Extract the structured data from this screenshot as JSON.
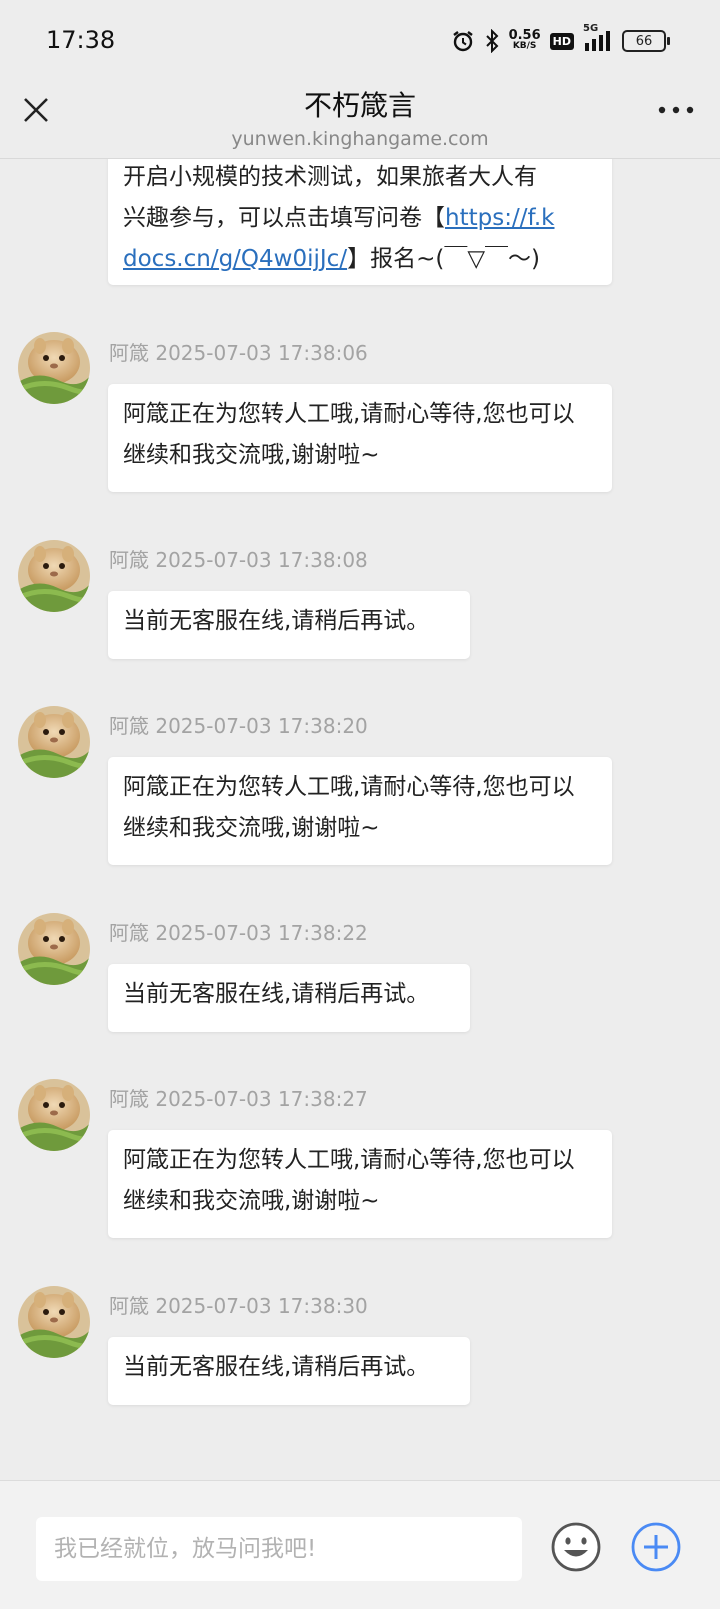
{
  "status_bar": {
    "time": "17:38",
    "net_speed_value": "0.56",
    "net_speed_unit": "KB/S",
    "hd_label": "HD",
    "network_label": "5G",
    "battery": "66"
  },
  "header": {
    "title": "不朽箴言",
    "subtitle": "yunwen.kinghangame.com"
  },
  "first_message": {
    "line1": "开启小规模的技术测试，如果旅者大人有",
    "line2_prefix": "兴趣参与，可以点击填写问卷【",
    "link_part1": "https://f.k",
    "link_part2": "docs.cn/g/Q4w0ijJc/",
    "line3_suffix": "】报名~(￣▽￣～)"
  },
  "messages": [
    {
      "sender": "阿箴",
      "timestamp": "2025-07-03 17:38:06",
      "text": "阿箴正在为您转人工哦,请耐心等待,您也可以继续和我交流哦,谢谢啦~"
    },
    {
      "sender": "阿箴",
      "timestamp": "2025-07-03 17:38:08",
      "text": "当前无客服在线,请稍后再试。"
    },
    {
      "sender": "阿箴",
      "timestamp": "2025-07-03 17:38:20",
      "text": "阿箴正在为您转人工哦,请耐心等待,您也可以继续和我交流哦,谢谢啦~"
    },
    {
      "sender": "阿箴",
      "timestamp": "2025-07-03 17:38:22",
      "text": "当前无客服在线,请稍后再试。"
    },
    {
      "sender": "阿箴",
      "timestamp": "2025-07-03 17:38:27",
      "text": "阿箴正在为您转人工哦,请耐心等待,您也可以继续和我交流哦,谢谢啦~"
    },
    {
      "sender": "阿箴",
      "timestamp": "2025-07-03 17:38:30",
      "text": "当前无客服在线,请稍后再试。"
    }
  ],
  "input": {
    "placeholder": "我已经就位，放马问我吧!"
  },
  "icons": {
    "close": "close-icon",
    "more": "more-dots-icon",
    "emoji": "emoji-icon",
    "plus": "plus-icon",
    "alarm": "alarm-icon",
    "bluetooth": "bluetooth-icon",
    "signal": "signal-icon"
  },
  "colors": {
    "background": "#ededed",
    "link": "#2a6fbd",
    "plus_accent": "#4a8af4"
  }
}
